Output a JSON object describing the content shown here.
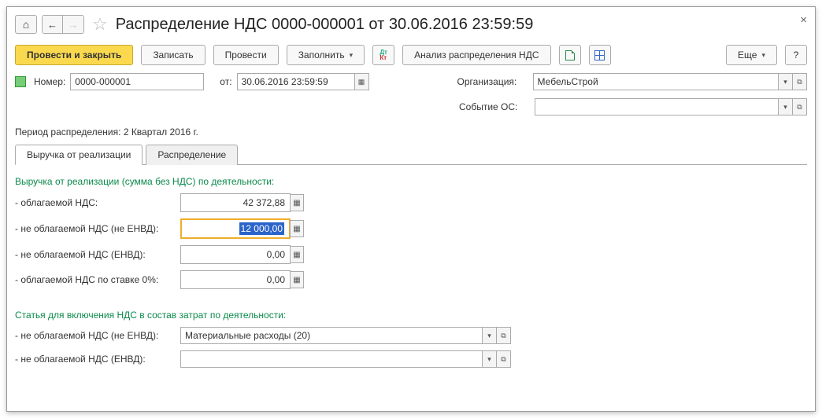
{
  "title": "Распределение НДС 0000-000001 от 30.06.2016 23:59:59",
  "toolbar": {
    "post_and_close": "Провести и закрыть",
    "save": "Записать",
    "post": "Провести",
    "fill": "Заполнить",
    "analysis": "Анализ распределения НДС",
    "more": "Еще",
    "help": "?"
  },
  "header": {
    "number_label": "Номер:",
    "number_value": "0000-000001",
    "date_label": "от:",
    "date_value": "30.06.2016 23:59:59",
    "org_label": "Организация:",
    "org_value": "МебельСтрой",
    "event_label": "Событие ОС:",
    "event_value": ""
  },
  "period": {
    "label": "Период распределения:",
    "value": "2 Квартал 2016  г."
  },
  "tabs": {
    "revenue": "Выручка от реализации",
    "distribution": "Распределение"
  },
  "section1_title": "Выручка от реализации (сумма без НДС) по деятельности:",
  "rows": {
    "taxable": {
      "label": "- облагаемой НДС:",
      "value": "42 372,88"
    },
    "nontax_noenvd": {
      "label": "- не облагаемой НДС (не ЕНВД):",
      "value": "12 000,00"
    },
    "nontax_envd": {
      "label": "- не облагаемой НДС (ЕНВД):",
      "value": "0,00"
    },
    "taxable0": {
      "label": "- облагаемой НДС по ставке 0%:",
      "value": "0,00"
    }
  },
  "section2_title": "Статья для включения НДС в состав затрат по деятельности:",
  "articles": {
    "nontax_noenvd": {
      "label": "- не облагаемой НДС (не ЕНВД):",
      "value": "Материальные расходы (20)"
    },
    "nontax_envd": {
      "label": "- не облагаемой НДС (ЕНВД):",
      "value": ""
    }
  }
}
